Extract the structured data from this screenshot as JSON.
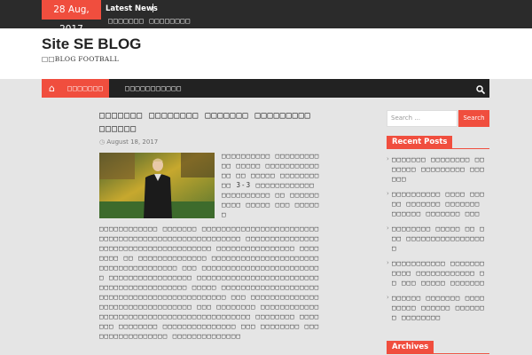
{
  "topbar": {
    "date": "28 Aug, 2017",
    "latest_label": "Latest News",
    "ticker": "□□□□□□□ □□□□□□□□"
  },
  "header": {
    "site_title": "Site SE BLOG",
    "site_description": "□□BLOG FOOTBALL"
  },
  "nav": {
    "home_icon": "⌂",
    "items": [
      {
        "label": "□□□□□□□"
      },
      {
        "label": "□□□□□□□□□□□"
      }
    ],
    "search_icon": "⚲"
  },
  "post": {
    "title": "□□□□□□□ □□□□□□□□ □□□□□□□ □□□□□□□□□ □□□□□□",
    "date": "August 18, 2017",
    "text_right": "□□□□□□□□□□ □□□□□□□□□□□ □□□□□ □□□□□□□□□□□□□ □□ □□□□□ □□□□□□□□□□ 3-3 □□□□□□□□□□□□ □□□□□□□□□□ □□ □□□□□□□□□□ □□□□□ □□□ □□□□□□",
    "text": "□□□□□□□□□□□□ □□□□□□□ □□□□□□□□□□□□□□□□□□□□□□□□□□□□□□□□□□□□□□□□□□□□□□□□□□□□□ □□□□□□□□□□□□□□□□□□□□□□□□□□□□□□□□□□□□□□ □□□□□□□□□□□□□□□□ □□□□□□□□ □□ □□□□□□□□□□□□□□ □□□□□□□□□□□□□□□□□□□□□□□□□□□□□□□□□□□□□□ □□□ □□□□□□□□□□□□□□□□□□□□□□□□□ □□□□□□□□□□□□□□□□□ □□□□□□□□□□□□□□□□□□□□□□□□□□□□□□□□□□□□□□□□□□□ □□□□□ □□□□□□□□□□□□□□□□□□□□□□□□□□□□□□□□□□□□□□□□□□□□□□ □□□ □□□□□□□□□□□□□□□□□□□□□□□□□□□□□□□□□ □□□ □□□□□□□□ □□□□□□□□□□□□□□□□□□□□□□□□□□□□□□□□□□□□□□□□□□□ □□□□□□□□ □□□□□□□ □□□□□□□□ □□□□□□□□□□□□□□□ □□□ □□□□□□□□ □□□□□□□□□□□□□□□□□ □□□□□□□□□□□□□□"
  },
  "sidebar": {
    "search_placeholder": "Search ...",
    "search_button": "Search",
    "recent_title": "Recent Posts",
    "recent_posts": [
      "□□□□□□□ □□□□□□□□ □□□□□□□ □□□□□□□□□ □□□□□□",
      "□□□□□□□□□□ □□□□ □□□□□ □□□□□□□ □□□□□□□ □□□□□□ □□□□□□□ □□□",
      "□□□□□□□□ □□□□□ □□ □□□ □□□□□□□□□□□□□□□□□",
      "□□□□□□□□□□□ □□□□□□□□□□□ □□□□□□□□□□□□ □□ □□□ □□□□□ □□□□□□□",
      "□□□□□□ □□□□□□□ □□□□□□□□□ □□□□□□ □□□□□□□ □□□□□□□□"
    ],
    "archives_title": "Archives"
  },
  "colors": {
    "accent": "#f04e3e",
    "dark": "#222222",
    "page_bg": "#e5e5e5"
  }
}
